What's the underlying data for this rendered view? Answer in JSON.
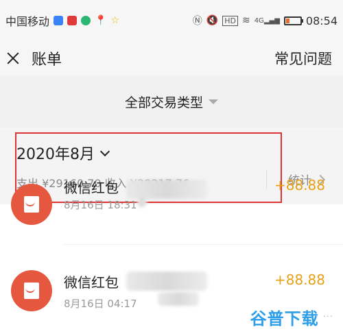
{
  "status_bar": {
    "carrier": "中国移动",
    "time": "08:54",
    "signal_text": "4G",
    "icons": [
      "nfc-icon",
      "mute-icon",
      "hd-icon",
      "wifi-icon",
      "signal-icon",
      "battery-icon"
    ],
    "app_icon_colors": [
      "#3b82f6",
      "#e03b3b",
      "#2bb673",
      "#e8474c",
      "#f3b700"
    ],
    "battery_level_percent": 20
  },
  "header": {
    "title": "账单",
    "help_label": "常见问题"
  },
  "filter": {
    "label": "全部交易类型"
  },
  "summary": {
    "month": "2020年8月",
    "totals": "支出 ¥29160.70 收入 ¥28217.76",
    "stats_label": "统计"
  },
  "transactions": [
    {
      "title": "微信红包",
      "date": "8月16日 18:31",
      "amount": "+88.88"
    },
    {
      "title": "微信红包",
      "date": "8月16日 04:17",
      "amount": "+88.88"
    }
  ],
  "watermark": {
    "text": "谷普下载"
  },
  "colors": {
    "accent_amount": "#e6a118",
    "avatar_red": "#e5573f",
    "highlight_border": "#dd3333"
  }
}
